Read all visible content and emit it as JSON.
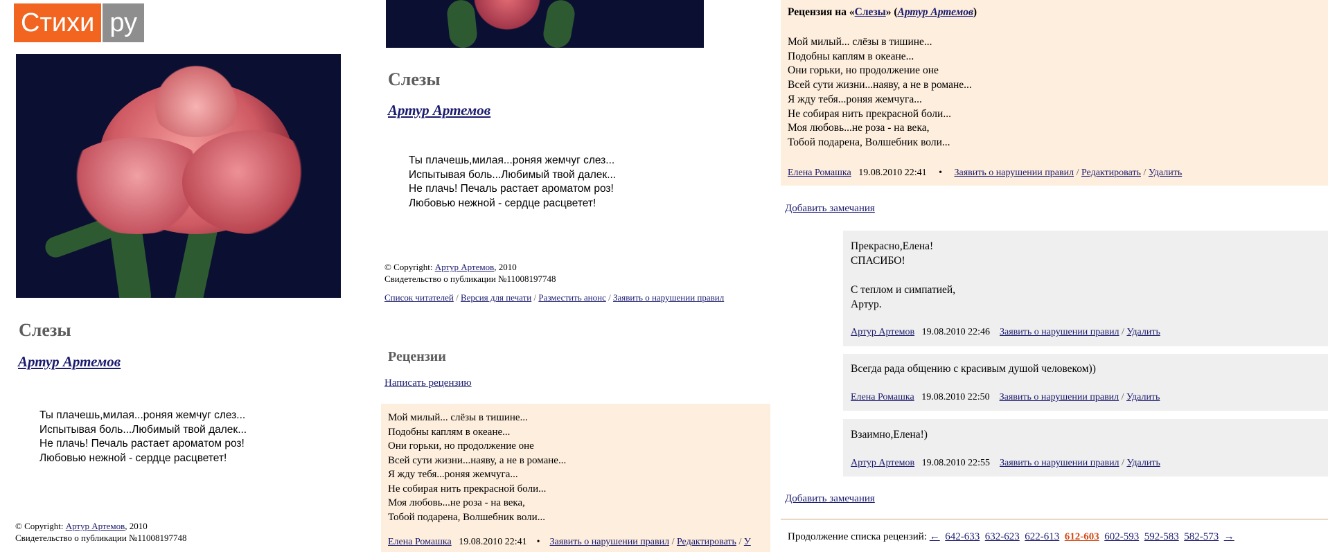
{
  "logo": {
    "part1": "Стихи",
    "part2": "ру"
  },
  "poem": {
    "title": "Слезы",
    "author": "Артур Артемов",
    "lines": "Ты плачешь,милая...роняя жемчуг слез...\nИспытывая боль...Любимый твой далек...\nНе плачь! Печаль растает ароматом роз!\nЛюбовью нежной - сердце расцветет!"
  },
  "copyright": {
    "prefix": "© Copyright:",
    "author": "Артур Артемов",
    "year": ", 2010",
    "certificate": "Свидетельство о публикации №11008197748"
  },
  "actions": {
    "readers": "Список читателей",
    "print": "Версия для печати",
    "announce": "Разместить анонс",
    "report": "Заявить о нарушении правил"
  },
  "reviews": {
    "heading": "Рецензии",
    "write": "Написать рецензию",
    "text": "Мой милый... слёзы в тишине...\nПодобны каплям в океане...\nОни горьки, но продолжение оне\nВсей сути жизни...наяву, а не в романе...\nЯ жду тебя...роняя жемчуга...\nНе собирая нить прекрасной боли...\nМоя любовь...не роза - на века,\nТобой подарена, Волшебник воли...",
    "author": "Елена Ромашка",
    "date": "19.08.2010 22:41",
    "bullet": "•",
    "report": "Заявить о нарушении правил",
    "edit": "Редактировать",
    "delete": "Удалить",
    "delete_cut": "У"
  },
  "review_header": {
    "prefix": "Рецензия на «",
    "work": "Слезы",
    "suffix": "» (",
    "author": "Артур Артемов",
    "close": ")"
  },
  "add_note": "Добавить замечания",
  "comments": [
    {
      "text": "Прекрасно,Елена!\nСПАСИБО!\n\nС теплом и симпатией,\nАртур.",
      "author": "Артур Артемов",
      "date": "19.08.2010 22:46",
      "report": "Заявить о нарушении правил",
      "delete": "Удалить"
    },
    {
      "text": "Всегда рада общению с красивым душой человеком))",
      "author": "Елена Ромашка",
      "date": "19.08.2010 22:50",
      "report": "Заявить о нарушении правил",
      "delete": "Удалить"
    },
    {
      "text": "Взаимно,Елена!)",
      "author": "Артур Артемов",
      "date": "19.08.2010 22:55",
      "report": "Заявить о нарушении правил",
      "delete": "Удалить"
    }
  ],
  "pager": {
    "label": "Продолжение списка рецензий:",
    "prev": "←",
    "next": "→",
    "pages": [
      "642-633",
      "632-623",
      "622-613",
      "612-603",
      "602-593",
      "592-583",
      "582-573"
    ],
    "current": "612-603"
  },
  "colors": {
    "logo_orange": "#f26521",
    "logo_gray": "#8e8e8e",
    "review_bg": "#fdeedd",
    "comment_bg": "#efefef",
    "link": "#1a1a6e",
    "current_page": "#d04b19"
  }
}
